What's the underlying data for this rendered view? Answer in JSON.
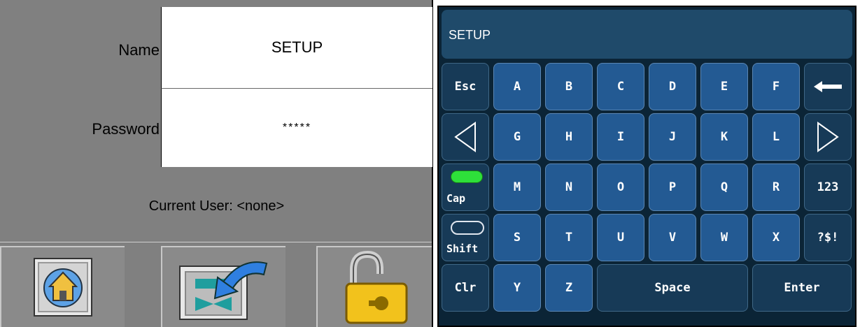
{
  "login": {
    "name_label": "Name",
    "name_value": "SETUP",
    "password_label": "Password",
    "password_value": "*****",
    "current_user": "Current User: <none>"
  },
  "keyboard": {
    "display_text": "SETUP",
    "rows": [
      [
        "Esc",
        "A",
        "B",
        "C",
        "D",
        "E",
        "F",
        "backspace-icon"
      ],
      [
        "left-arrow-icon",
        "G",
        "H",
        "I",
        "J",
        "K",
        "L",
        "right-arrow-icon"
      ],
      [
        "Cap",
        "M",
        "N",
        "O",
        "P",
        "Q",
        "R",
        "123"
      ],
      [
        "Shift",
        "S",
        "T",
        "U",
        "V",
        "W",
        "X",
        "?$!"
      ],
      [
        "Clr",
        "Y",
        "Z",
        "Space",
        "Enter"
      ]
    ],
    "keys": {
      "esc": "Esc",
      "a": "A",
      "b": "B",
      "c": "C",
      "d": "D",
      "e": "E",
      "f": "F",
      "g": "G",
      "h": "H",
      "i": "I",
      "j": "J",
      "k": "K",
      "l": "L",
      "cap": "Cap",
      "m": "M",
      "n": "N",
      "o": "O",
      "p": "P",
      "q": "Q",
      "r": "R",
      "num": "123",
      "shift": "Shift",
      "s": "S",
      "t": "T",
      "u": "U",
      "v": "V",
      "w": "W",
      "x": "X",
      "sym": "?$!",
      "clr": "Clr",
      "y": "Y",
      "z": "Z",
      "space": "Space",
      "enter": "Enter"
    }
  },
  "colors": {
    "panel_gray": "#808080",
    "key_blue": "#235a93",
    "key_dark": "#173a57",
    "caps_indicator_on": "#2ee03a"
  }
}
